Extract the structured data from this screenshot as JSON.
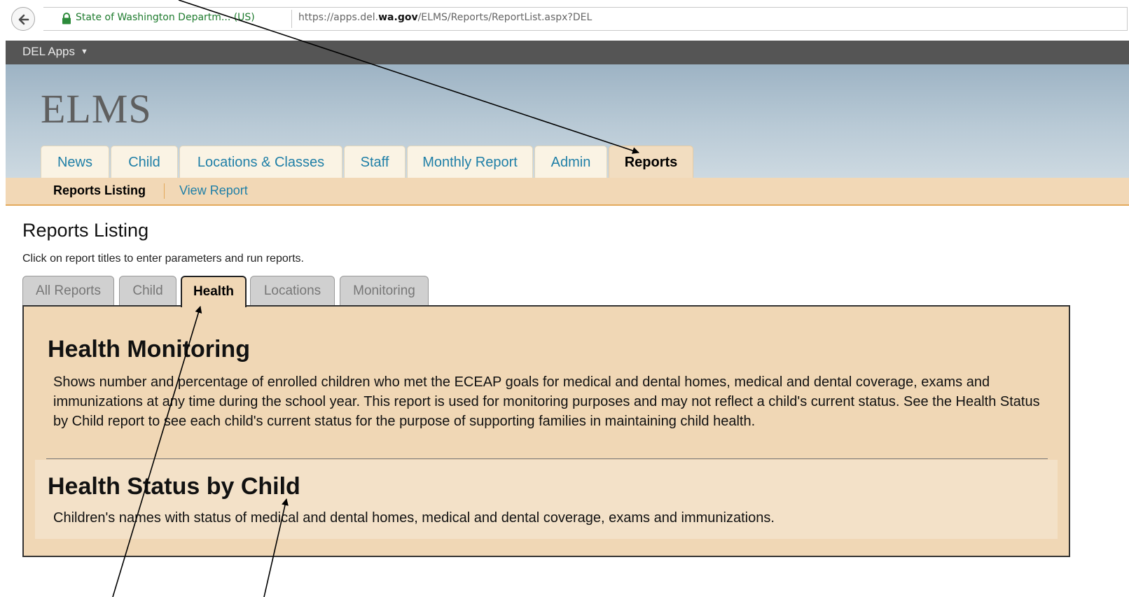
{
  "browser": {
    "site_identity": "State of Washington Departm... (US)",
    "url_prefix": "https://apps.del.",
    "url_domain": "wa.gov",
    "url_path": "/ELMS/Reports/ReportList.aspx?DEL"
  },
  "apps_bar": {
    "menu_label": "DEL Apps",
    "caret": "▼"
  },
  "header": {
    "app_title": "ELMS",
    "tabs": [
      {
        "label": "News"
      },
      {
        "label": "Child"
      },
      {
        "label": "Locations & Classes"
      },
      {
        "label": "Staff"
      },
      {
        "label": "Monthly Report"
      },
      {
        "label": "Admin"
      },
      {
        "label": "Reports",
        "active": true
      }
    ]
  },
  "subnav": {
    "active": "Reports Listing",
    "link": "View Report"
  },
  "main": {
    "page_title": "Reports Listing",
    "intro": "Click on report titles to enter parameters and run reports.",
    "report_tabs": [
      {
        "label": "All Reports"
      },
      {
        "label": "Child"
      },
      {
        "label": "Health",
        "active": true
      },
      {
        "label": "Locations"
      },
      {
        "label": "Monitoring"
      }
    ],
    "reports": [
      {
        "title": "Health Monitoring",
        "description": "Shows number and percentage of enrolled children who met the ECEAP goals for medical and dental homes, medical and dental coverage, exams and immunizations at any time during the school year. This report is used for monitoring purposes and may not reflect a child's current status. See the Health Status by Child report to see each child's current status for the purpose of supporting families in maintaining child health."
      },
      {
        "title": "Health Status by Child",
        "description": "Children's names with status of medical and dental homes, medical and dental coverage, exams and immunizations."
      }
    ]
  },
  "colors": {
    "link": "#1f7fa7",
    "tab_bg": "#faf3e4",
    "active_tab_bg": "#f2ddc0",
    "panel_bg": "#f0d7b5",
    "subnav_border": "#e3a95b",
    "apps_bar": "#555555",
    "secure_green": "#1e7b2e"
  },
  "icons": [
    "back-arrow-icon",
    "lock-icon",
    "dropdown-caret-icon"
  ]
}
